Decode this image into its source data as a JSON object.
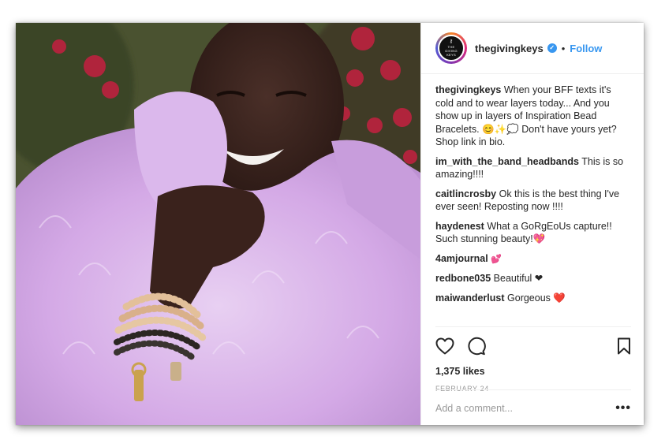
{
  "post": {
    "username": "thegivingkeys",
    "avatar_text": [
      "THE",
      "GIVING",
      "KEYS"
    ],
    "verified_icon": "verified-check-icon",
    "separator": "•",
    "follow_label": "Follow",
    "image_alt": "Smiling woman wrapped in a lilac faux fur coat wearing stacked wooden bead bracelets with a key charm, red flowers behind her"
  },
  "comments": [
    {
      "user": "thegivingkeys",
      "text": "When your BFF texts it's cold and to wear layers today... And you show up in layers of Inspiration Bead Bracelets. 😊✨💭 Don't have yours yet? Shop link in bio."
    },
    {
      "user": "im_with_the_band_headbands",
      "text": "This is so amazing!!!!"
    },
    {
      "user": "caitlincrosby",
      "text": "Ok this is the best thing I've ever seen! Reposting now !!!!"
    },
    {
      "user": "haydenest",
      "text": "What a GoRgEoUs capture!! Such stunning beauty!💖"
    },
    {
      "user": "4amjournal",
      "text": "💕"
    },
    {
      "user": "redbone035",
      "text": "Beautiful ❤"
    },
    {
      "user": "maiwanderlust",
      "text": "Gorgeous ❤️"
    }
  ],
  "actions": {
    "icons": [
      "heart-icon",
      "comment-icon",
      "bookmark-icon"
    ],
    "likes": "1,375 likes",
    "date": "FEBRUARY 24"
  },
  "add_comment": {
    "placeholder": "Add a comment...",
    "more_label": "•••"
  },
  "colors": {
    "link_blue": "#3897f0",
    "border": "#efefef",
    "muted": "#999999",
    "coat_lilac": "#d9b3ea"
  }
}
